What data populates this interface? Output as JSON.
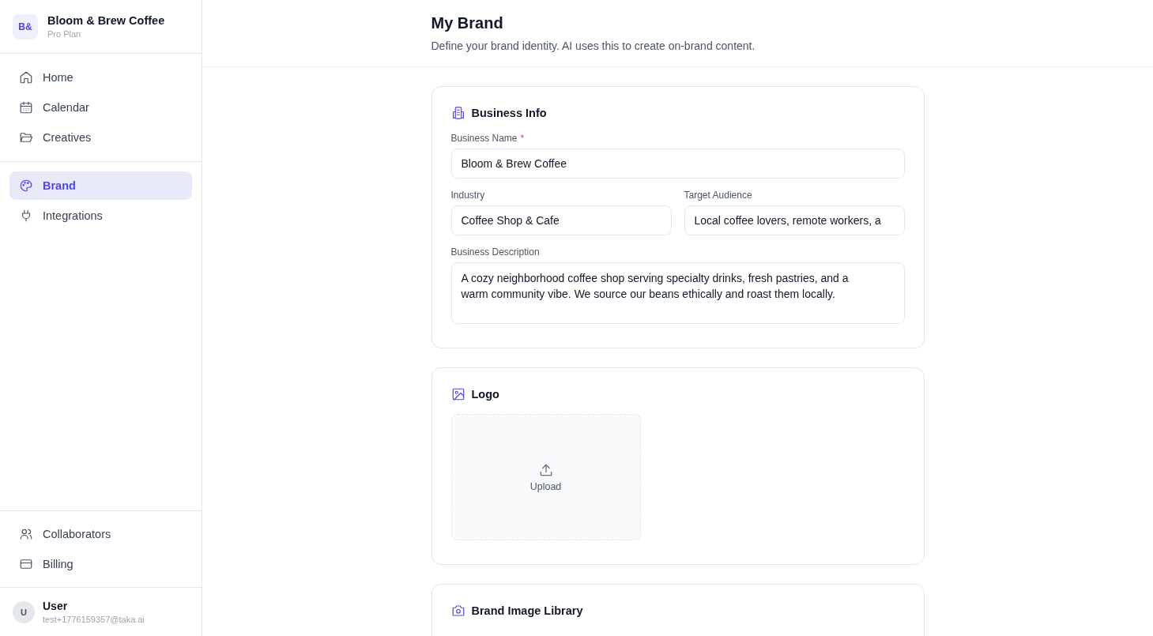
{
  "workspace": {
    "initials": "B&",
    "name": "Bloom & Brew Coffee",
    "plan": "Pro Plan"
  },
  "sidebar": {
    "groups": [
      {
        "items": [
          {
            "label": "Home",
            "selected": false
          },
          {
            "label": "Calendar",
            "selected": false
          },
          {
            "label": "Creatives",
            "selected": false
          }
        ]
      },
      {
        "items": [
          {
            "label": "Brand",
            "selected": true
          },
          {
            "label": "Integrations",
            "selected": false
          }
        ]
      }
    ],
    "bottom_items": [
      {
        "label": "Collaborators",
        "selected": false
      },
      {
        "label": "Billing",
        "selected": false
      }
    ],
    "user": {
      "initial": "U",
      "name": "User",
      "email": "test+1776159357@taka.ai"
    }
  },
  "page": {
    "title": "My Brand",
    "subtitle": "Define your brand identity. AI uses this to create on-brand content."
  },
  "business_info": {
    "title": "Business Info",
    "required_mark": "*",
    "fields": [
      {
        "label": "Business Name",
        "required": true,
        "value": "Bloom & Brew Coffee",
        "kind": "full"
      },
      {
        "label": "Industry",
        "required": false,
        "value": "Coffee Shop & Cafe",
        "kind": "half"
      },
      {
        "label": "Target Audience",
        "required": false,
        "value": "Local coffee lovers, remote workers, a",
        "kind": "half"
      },
      {
        "label": "Business Description",
        "required": false,
        "value": "A cozy neighborhood coffee shop serving specialty drinks, fresh pastries, and a warm community vibe. We source our beans ethically and roast them locally.",
        "kind": "textarea"
      }
    ]
  },
  "logo": {
    "title": "Logo",
    "upload_label": "Upload"
  },
  "image_library": {
    "title": "Brand Image Library"
  }
}
